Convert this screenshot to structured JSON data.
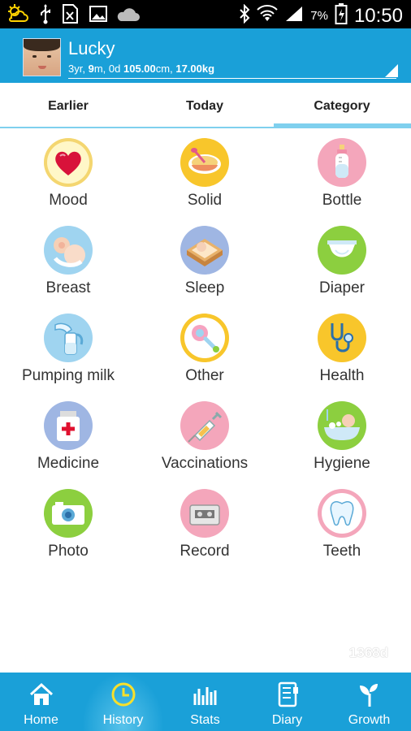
{
  "status_bar": {
    "battery_percent": "7%",
    "time": "10:50",
    "icons": [
      "weather-icon",
      "usb-icon",
      "sim-icon",
      "image-icon",
      "cloud-icon",
      "bluetooth-icon",
      "wifi-icon",
      "signal-icon",
      "battery-icon"
    ]
  },
  "header": {
    "child_name": "Lucky",
    "info_prefix": "3yr,",
    "info_months": "9",
    "info_m": "m,",
    "info_days": "0d",
    "info_height": "105.00",
    "info_cm": "cm,",
    "info_weight": "17.00",
    "info_kg": "kg"
  },
  "tabs": [
    {
      "label": "Earlier"
    },
    {
      "label": "Today"
    },
    {
      "label": "Category"
    }
  ],
  "active_tab": "Category",
  "categories": [
    {
      "label": "Mood",
      "icon": "heart-icon"
    },
    {
      "label": "Solid",
      "icon": "bowl-icon"
    },
    {
      "label": "Bottle",
      "icon": "bottle-icon"
    },
    {
      "label": "Breast",
      "icon": "breastfeeding-icon"
    },
    {
      "label": "Sleep",
      "icon": "crib-icon"
    },
    {
      "label": "Diaper",
      "icon": "diaper-icon"
    },
    {
      "label": "Pumping milk",
      "icon": "breast-pump-icon"
    },
    {
      "label": "Other",
      "icon": "rattle-icon"
    },
    {
      "label": "Health",
      "icon": "stethoscope-icon"
    },
    {
      "label": "Medicine",
      "icon": "medicine-bottle-icon"
    },
    {
      "label": "Vaccinations",
      "icon": "syringe-icon"
    },
    {
      "label": "Hygiene",
      "icon": "bath-icon"
    },
    {
      "label": "Photo",
      "icon": "camera-icon"
    },
    {
      "label": "Record",
      "icon": "cassette-icon"
    },
    {
      "label": "Teeth",
      "icon": "tooth-icon"
    }
  ],
  "age_days": "1368d",
  "bottom_nav": [
    {
      "label": "Home",
      "icon": "home-icon"
    },
    {
      "label": "History",
      "icon": "clock-icon"
    },
    {
      "label": "Stats",
      "icon": "bar-chart-icon"
    },
    {
      "label": "Diary",
      "icon": "notebook-icon"
    },
    {
      "label": "Growth",
      "icon": "sprout-icon"
    }
  ],
  "active_nav": "History",
  "colors": {
    "header_blue": "#1aa0d8",
    "tab_indicator": "#7fd0ee"
  }
}
